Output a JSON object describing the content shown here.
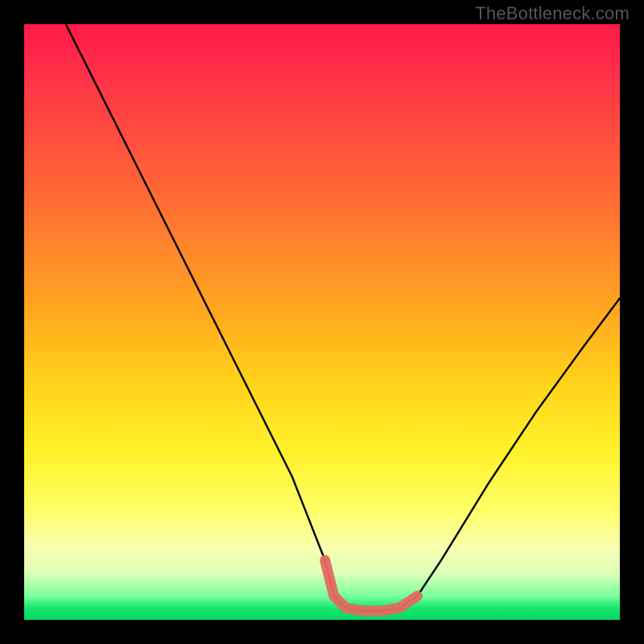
{
  "watermark": "TheBottleneck.com",
  "chart_data": {
    "type": "line",
    "title": "",
    "xlabel": "",
    "ylabel": "",
    "xlim": [
      0,
      1
    ],
    "ylim": [
      0,
      1
    ],
    "series": [
      {
        "name": "curve",
        "x": [
          0.07,
          0.15,
          0.25,
          0.35,
          0.45,
          0.505,
          0.52,
          0.54,
          0.57,
          0.6,
          0.63,
          0.66,
          0.7,
          0.78,
          0.86,
          0.94,
          1.0
        ],
        "y": [
          1.0,
          0.84,
          0.64,
          0.44,
          0.24,
          0.1,
          0.04,
          0.02,
          0.015,
          0.015,
          0.02,
          0.04,
          0.1,
          0.23,
          0.35,
          0.46,
          0.54
        ]
      },
      {
        "name": "bottom-highlight",
        "x": [
          0.505,
          0.52,
          0.54,
          0.57,
          0.6,
          0.63,
          0.66
        ],
        "y": [
          0.1,
          0.04,
          0.02,
          0.015,
          0.015,
          0.02,
          0.04
        ]
      }
    ],
    "colors": {
      "curve": "#000000",
      "bottom_highlight": "#e36a62",
      "gradient_top": "#ff1946",
      "gradient_bottom": "#07d765"
    }
  }
}
